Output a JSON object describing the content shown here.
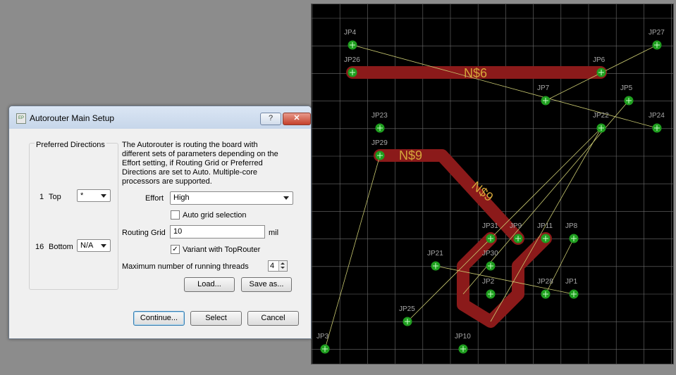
{
  "dialog": {
    "title": "Autorouter Main Setup",
    "help_label": "?",
    "close_label": "✕",
    "icon_text": "EP",
    "preferred_directions": {
      "title": "Preferred Directions",
      "top": {
        "layer": "1",
        "name": "Top",
        "value": "*"
      },
      "bottom": {
        "layer": "16",
        "name": "Bottom",
        "value": "N/A"
      }
    },
    "description": "The Autorouter is routing the board with different sets of parameters depending on the Effort setting, if Routing Grid or Preferred Directions are set to Auto. Multiple-core processors are supported.",
    "effort": {
      "label": "Effort",
      "value": "High"
    },
    "auto_grid": {
      "label": "Auto grid selection",
      "checked": false
    },
    "routing_grid": {
      "label": "Routing Grid",
      "value": "10",
      "unit": "mil"
    },
    "variant": {
      "label": "Variant with TopRouter",
      "checked": true,
      "mark": "✓"
    },
    "threads": {
      "label": "Maximum number of running threads",
      "value": "4"
    },
    "buttons": {
      "load": "Load...",
      "save_as": "Save as...",
      "continue": "Continue...",
      "select": "Select",
      "cancel": "Cancel"
    }
  },
  "board": {
    "colors": {
      "background": "#000000",
      "grid": "#6e6e6e",
      "trace": "#8b1a1a",
      "pad": "#1f9e1f",
      "airwire": "#c8c870",
      "net_label": "#d6a63a",
      "pad_label": "#a8a8a8"
    },
    "net_labels": [
      "N$6",
      "N$9",
      "N$9"
    ],
    "pads": [
      "JP4",
      "JP27",
      "JP26",
      "JP6",
      "JP7",
      "JP5",
      "JP23",
      "JP22",
      "JP24",
      "JP29",
      "JP31",
      "JP9",
      "JP11",
      "JP8",
      "JP21",
      "JP30",
      "JP2",
      "JP28",
      "JP1",
      "JP25",
      "JP3",
      "JP10"
    ]
  }
}
